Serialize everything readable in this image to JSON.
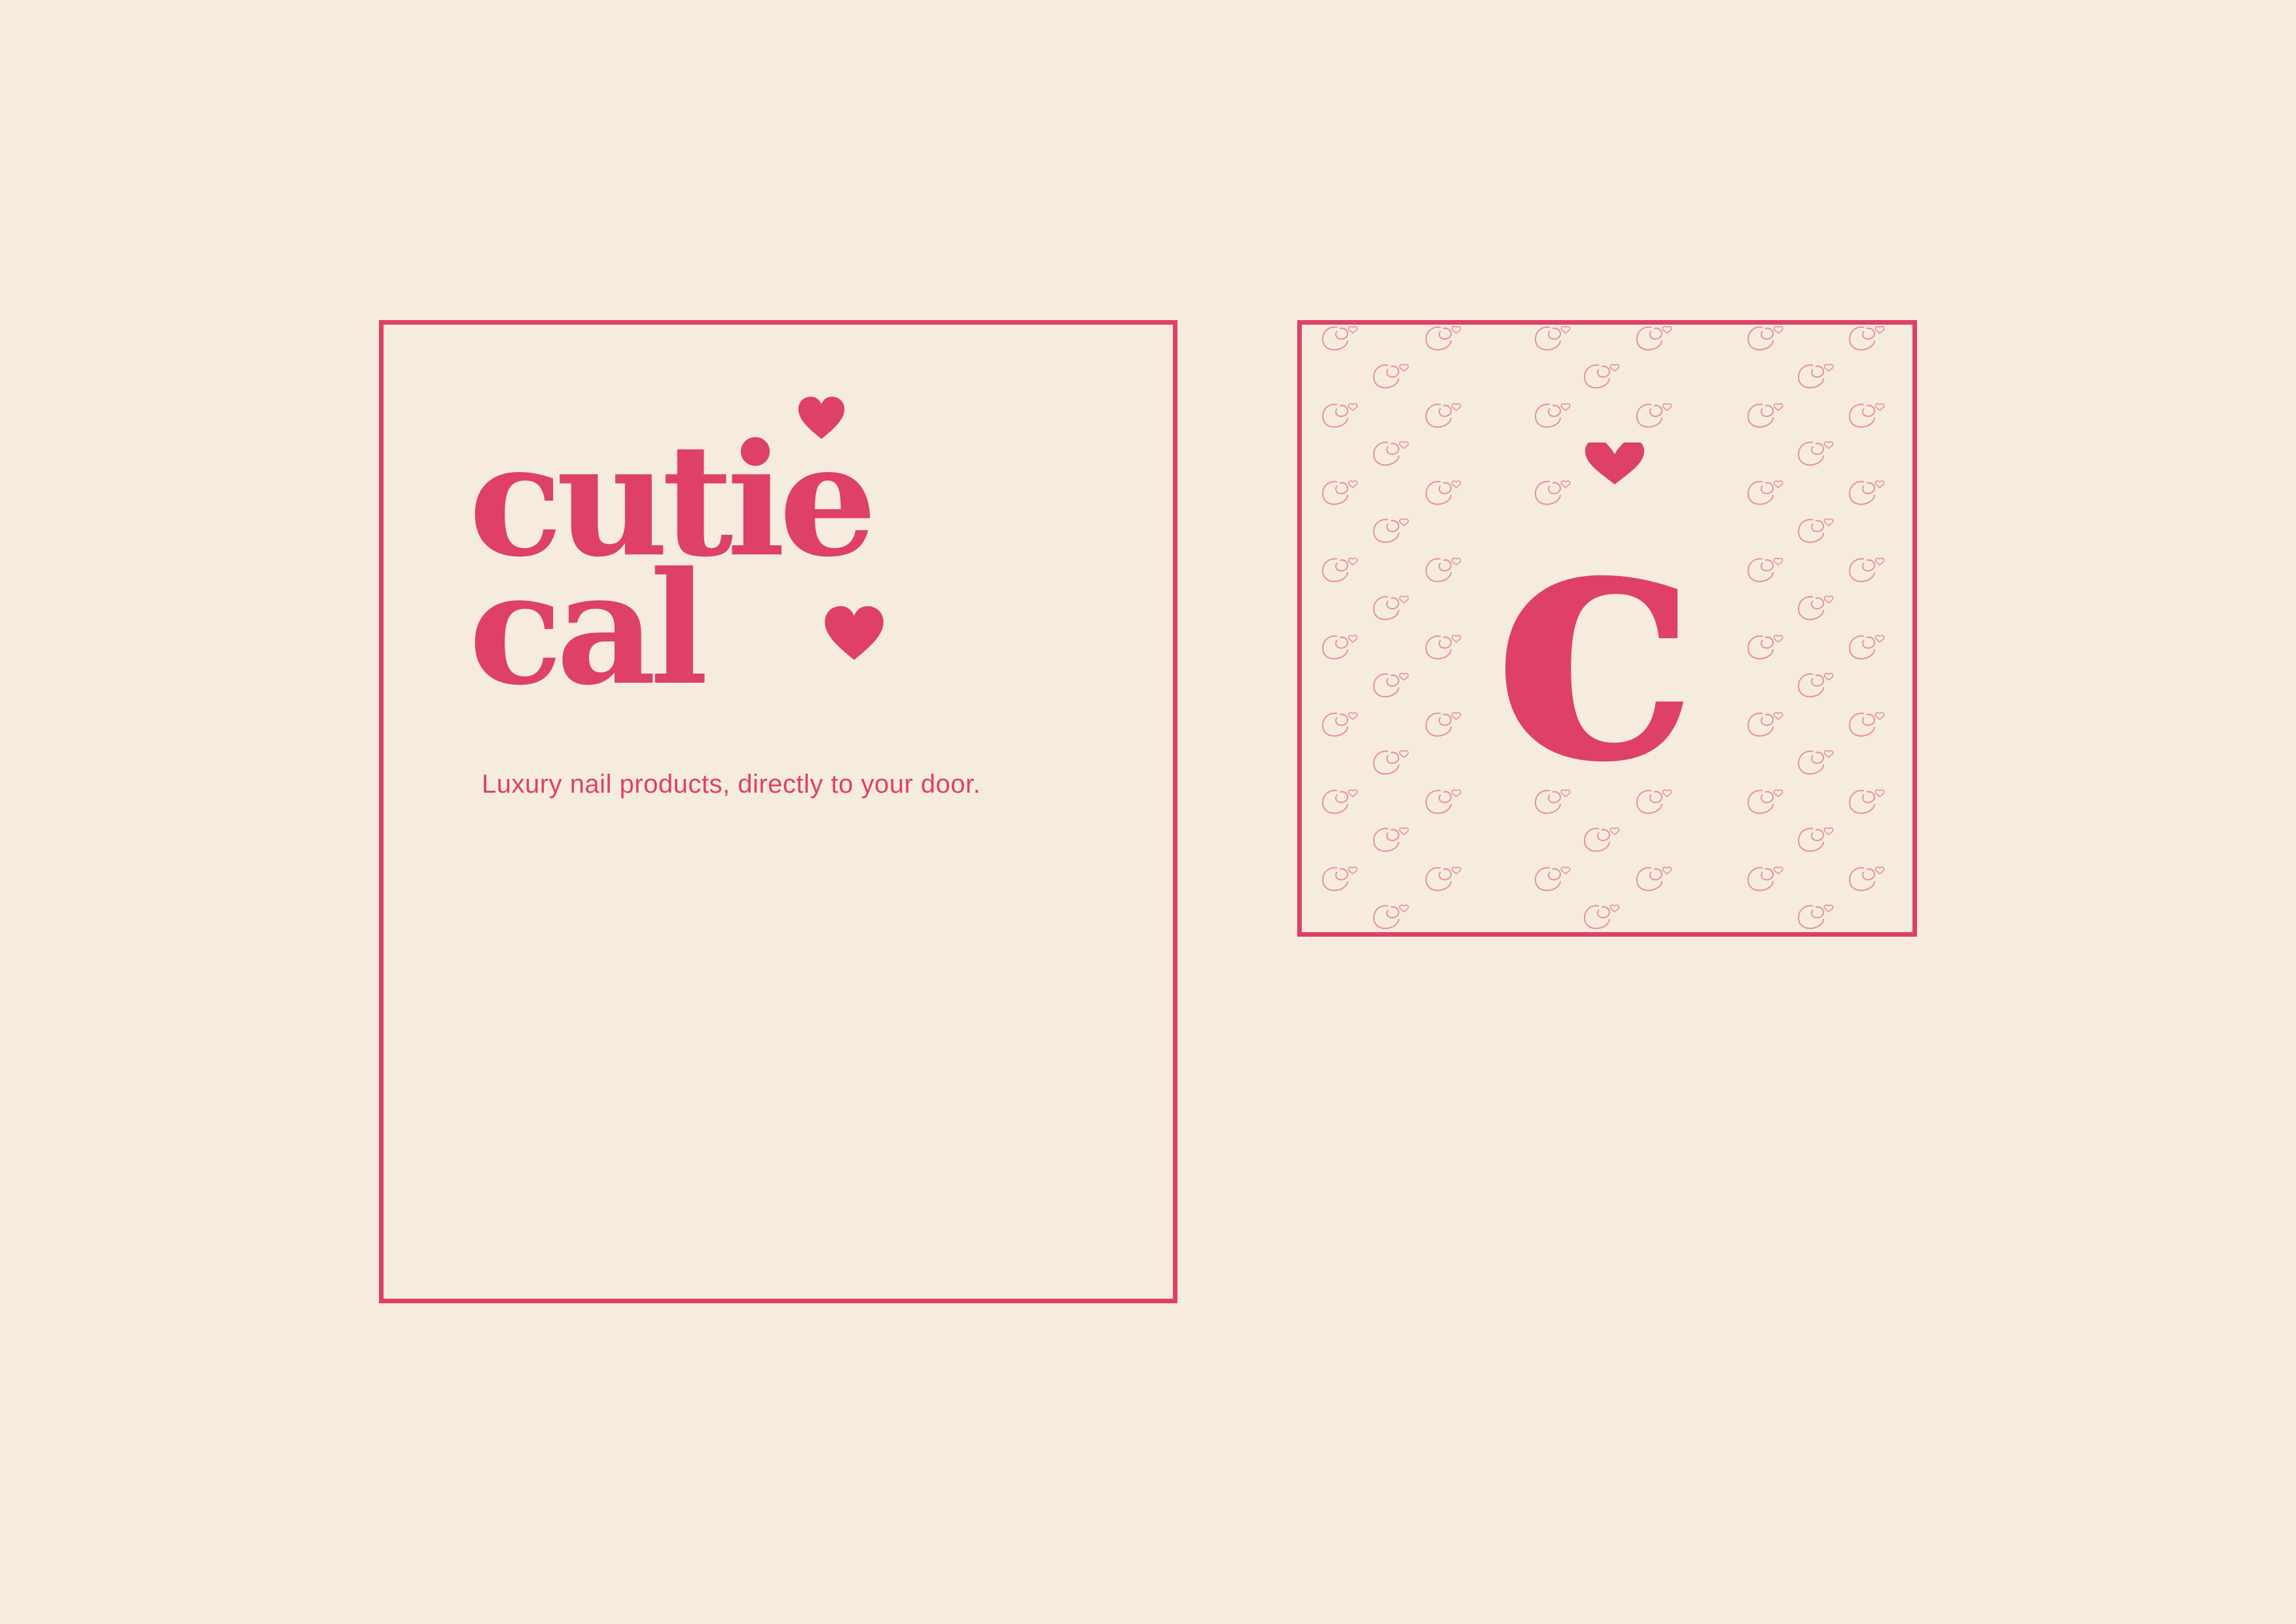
{
  "brand": {
    "name_line_1": "cutie",
    "name_line_2": "cal",
    "tagline": "Luxury nail products, directly to your door.",
    "monogram_letter": "c"
  },
  "colors": {
    "background": "#f6ecde",
    "accent": "#de4067",
    "pattern": "#e6909f"
  },
  "icons": {
    "logo_heart": "heart-icon",
    "pattern_tile": "c-heart-monogram-icon"
  }
}
